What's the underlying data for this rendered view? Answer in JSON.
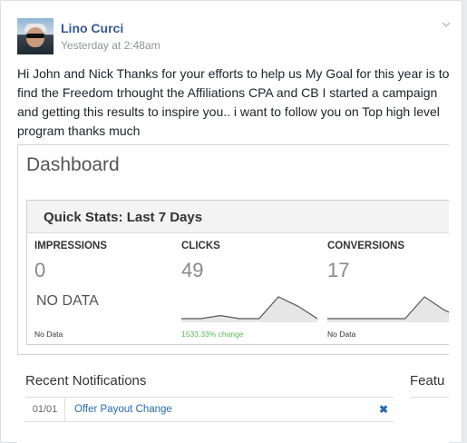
{
  "post": {
    "author": "Lino Curci",
    "time": "Yesterday at 2:48am",
    "text": "Hi John and Nick Thanks for your efforts to help us My Goal for this year is to find the Freedom trhought the Affiliations CPA and CB I started a campaign and getting this results to inspire you.. i want to follow you on Top high level program thanks much"
  },
  "dashboard": {
    "title": "Dashboard",
    "quick_stats_title": "Quick Stats: Last 7 Days",
    "stats": [
      {
        "label": "IMPRESSIONS",
        "value": "0",
        "big_note": "NO DATA",
        "foot": "No Data"
      },
      {
        "label": "CLICKS",
        "value": "49",
        "foot": "1533.33% change"
      },
      {
        "label": "CONVERSIONS",
        "value": "17",
        "foot": "No Data"
      }
    ],
    "sparklines": {
      "clicks": [
        0,
        0,
        1,
        0,
        0,
        7,
        4,
        0
      ],
      "conversions": [
        0,
        0,
        0,
        0,
        0,
        5,
        2,
        0
      ]
    }
  },
  "notifications": {
    "title": "Recent Notifications",
    "items": [
      {
        "date": "01/01",
        "text": "Offer Payout Change",
        "close": "✖"
      }
    ]
  },
  "featured": {
    "title": "Featu"
  },
  "icons": {
    "menu": "chevron-down-icon",
    "close": "close-icon"
  }
}
